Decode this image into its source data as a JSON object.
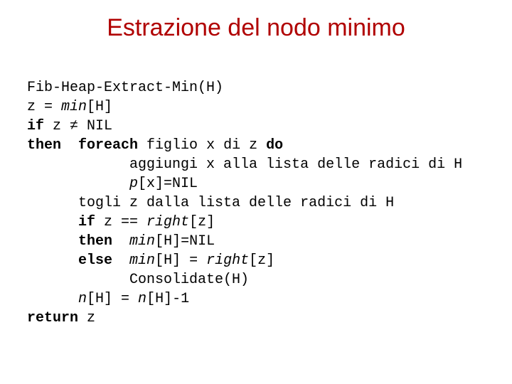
{
  "title": "Estrazione del nodo minimo",
  "code": {
    "l1": "Fib-Heap-Extract-Min(H)",
    "l2a": "z = ",
    "l2b": "min",
    "l2c": "[H]",
    "l3a": "if",
    "l3b": " z ≠ NIL",
    "l4a": "then",
    "l4b": "  ",
    "l4c": "foreach",
    "l4d": " figlio x di z ",
    "l4e": "do",
    "l5": "            aggiungi x alla lista delle radici di H",
    "l6a": "            ",
    "l6b": "p",
    "l6c": "[x]=NIL",
    "l7": "      togli z dalla lista delle radici di H",
    "l8a": "      ",
    "l8b": "if",
    "l8c": " z == ",
    "l8d": "right",
    "l8e": "[z]",
    "l9a": "      ",
    "l9b": "then",
    "l9c": "  ",
    "l9d": "min",
    "l9e": "[H]=NIL",
    "l10a": "      ",
    "l10b": "else",
    "l10c": "  ",
    "l10d": "min",
    "l10e": "[H] = ",
    "l10f": "right",
    "l10g": "[z]",
    "l11": "            Consolidate(H)",
    "l12a": "      ",
    "l12b": "n",
    "l12c": "[H] = ",
    "l12d": "n",
    "l12e": "[H]-1",
    "l13a": "return",
    "l13b": " z"
  }
}
